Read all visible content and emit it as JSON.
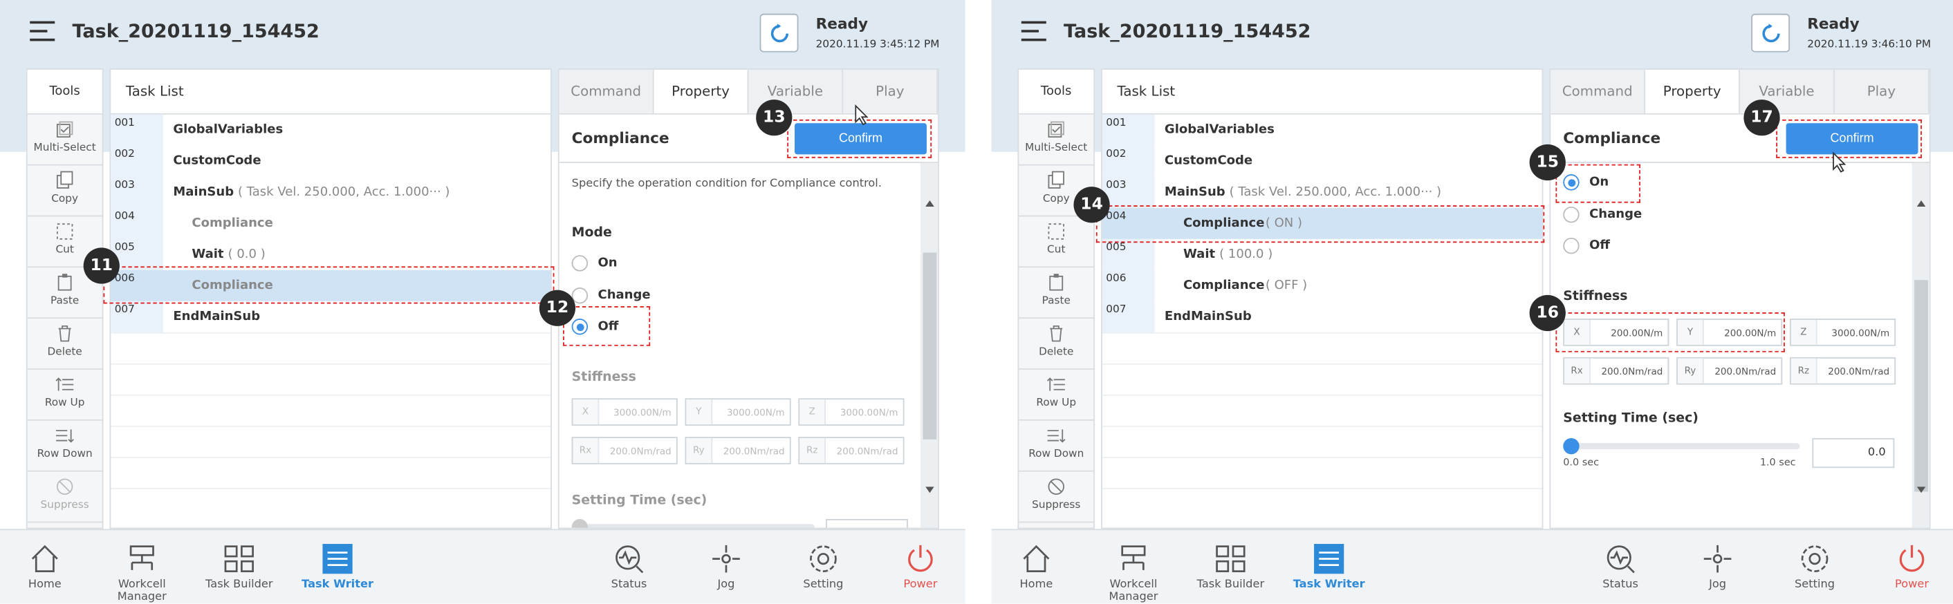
{
  "panels": [
    {
      "title": "Task_20201119_154452",
      "status": "Ready",
      "time": "2020.11.19 3:45:12 PM",
      "tools_header": "Tools",
      "tools": [
        "Multi-Select",
        "Copy",
        "Cut",
        "Paste",
        "Delete",
        "Row Up",
        "Row Down",
        "Suppress"
      ],
      "tasklist_header": "Task List",
      "rows": [
        {
          "num": "001",
          "text": "GlobalVariables",
          "sub": ""
        },
        {
          "num": "002",
          "text": "CustomCode",
          "sub": ""
        },
        {
          "num": "003",
          "text": "MainSub",
          "sub": "( Task Vel. 250.000, Acc. 1.000··· )"
        },
        {
          "num": "004",
          "text": "Compliance",
          "sub": ""
        },
        {
          "num": "005",
          "text": "Wait",
          "sub": "( 0.0 )"
        },
        {
          "num": "006",
          "text": "Compliance",
          "sub": ""
        },
        {
          "num": "007",
          "text": "EndMainSub",
          "sub": ""
        }
      ],
      "tabs": [
        "Command",
        "Property",
        "Variable",
        "Play"
      ],
      "prop_title": "Compliance",
      "confirm": "Confirm",
      "desc": "Specify the operation condition for Compliance control.",
      "mode_label": "Mode",
      "modes": [
        "On",
        "Change",
        "Off"
      ],
      "stiffness_label": "Stiffness",
      "fields": [
        {
          "k": "X",
          "v": "3000.00N/m"
        },
        {
          "k": "Y",
          "v": "3000.00N/m"
        },
        {
          "k": "Z",
          "v": "3000.00N/m"
        },
        {
          "k": "Rx",
          "v": "200.0Nm/rad"
        },
        {
          "k": "Ry",
          "v": "200.0Nm/rad"
        },
        {
          "k": "Rz",
          "v": "200.0Nm/rad"
        }
      ],
      "setting_time_label": "Setting Time (sec)",
      "badges": [
        "11",
        "12",
        "13"
      ]
    },
    {
      "title": "Task_20201119_154452",
      "status": "Ready",
      "time": "2020.11.19 3:46:10 PM",
      "tools_header": "Tools",
      "tools": [
        "Multi-Select",
        "Copy",
        "Cut",
        "Paste",
        "Delete",
        "Row Up",
        "Row Down",
        "Suppress"
      ],
      "tasklist_header": "Task List",
      "rows": [
        {
          "num": "001",
          "text": "GlobalVariables",
          "sub": ""
        },
        {
          "num": "002",
          "text": "CustomCode",
          "sub": ""
        },
        {
          "num": "003",
          "text": "MainSub",
          "sub": "( Task Vel. 250.000, Acc. 1.000··· )"
        },
        {
          "num": "004",
          "text": "Compliance",
          "sub": "( ON )"
        },
        {
          "num": "005",
          "text": "Wait",
          "sub": "( 100.0 )"
        },
        {
          "num": "006",
          "text": "Compliance",
          "sub": "( OFF )"
        },
        {
          "num": "007",
          "text": "EndMainSub",
          "sub": ""
        }
      ],
      "tabs": [
        "Command",
        "Property",
        "Variable",
        "Play"
      ],
      "prop_title": "Compliance",
      "confirm": "Confirm",
      "modes": [
        "On",
        "Change",
        "Off"
      ],
      "stiffness_label": "Stiffness",
      "fields": [
        {
          "k": "X",
          "v": "200.00N/m"
        },
        {
          "k": "Y",
          "v": "200.00N/m"
        },
        {
          "k": "Z",
          "v": "3000.00N/m"
        },
        {
          "k": "Rx",
          "v": "200.0Nm/rad"
        },
        {
          "k": "Ry",
          "v": "200.0Nm/rad"
        },
        {
          "k": "Rz",
          "v": "200.0Nm/rad"
        }
      ],
      "setting_time_label": "Setting Time (sec)",
      "slider_min": "0.0 sec",
      "slider_max": "1.0 sec",
      "setting_time_value": "0.0",
      "badges": [
        "14",
        "15",
        "16",
        "17"
      ]
    }
  ],
  "nav": [
    "Home",
    "Workcell Manager",
    "Task Builder",
    "Task Writer",
    "Status",
    "Jog",
    "Setting",
    "Power"
  ],
  "colors": {
    "accent": "#3a8fe6",
    "topbar": "#dfe9f1",
    "selected_row": "#cfe3f5",
    "annotation": "#e02020",
    "power": "#e4524b"
  }
}
